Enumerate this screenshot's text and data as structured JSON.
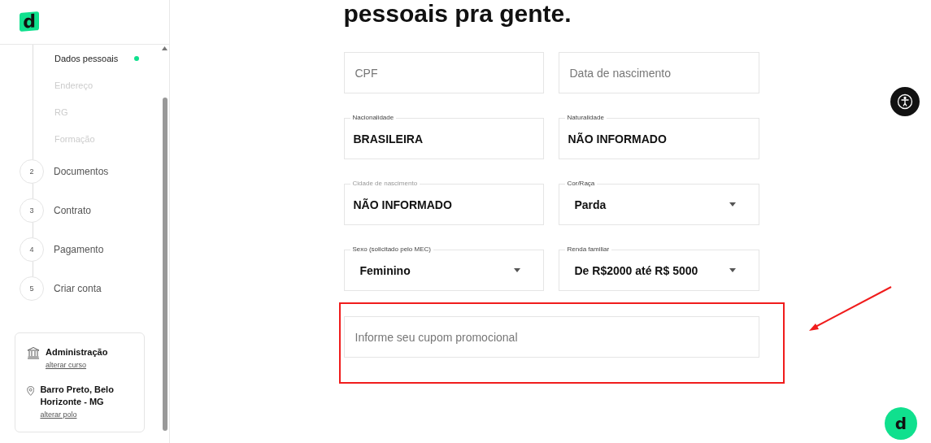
{
  "logo": "d",
  "steps": {
    "substeps": [
      {
        "label": "Dados pessoais",
        "selected": true
      },
      {
        "label": "Endereço",
        "selected": false
      },
      {
        "label": "RG",
        "selected": false
      },
      {
        "label": "Formação",
        "selected": false
      }
    ],
    "items": [
      {
        "number": "2",
        "label": "Documentos"
      },
      {
        "number": "3",
        "label": "Contrato"
      },
      {
        "number": "4",
        "label": "Pagamento"
      },
      {
        "number": "5",
        "label": "Criar conta"
      }
    ]
  },
  "summary": [
    {
      "kind": "course",
      "title": "Administração",
      "link": "alterar curso"
    },
    {
      "kind": "location",
      "title": "Barro Preto, Belo Horizonte - MG",
      "link": "alterar polo"
    }
  ],
  "heading": "pessoais pra gente.",
  "fields": [
    {
      "kind": "text",
      "placeholder": "CPF"
    },
    {
      "kind": "text",
      "placeholder": "Data de nascimento"
    },
    {
      "kind": "text",
      "label": "Nacionalidade",
      "value": "BRASILEIRA",
      "disabled": false
    },
    {
      "kind": "text",
      "label": "Naturalidade",
      "value": "NÃO INFORMADO",
      "disabled": false
    },
    {
      "kind": "text",
      "label": "Cidade de nascimento",
      "value": "NÃO INFORMADO",
      "disabled": true
    },
    {
      "kind": "select",
      "label": "Cor/Raça",
      "value": "Parda"
    },
    {
      "kind": "select",
      "label": "Sexo (solicitado pelo MEC)",
      "value": "Feminino"
    },
    {
      "kind": "select",
      "label": "Renda familiar",
      "value": "De R$2000 até R$ 5000"
    }
  ],
  "coupon": {
    "placeholder": "Informe seu cupom promocional",
    "highlighted": true
  },
  "chat": {
    "label": "d"
  }
}
